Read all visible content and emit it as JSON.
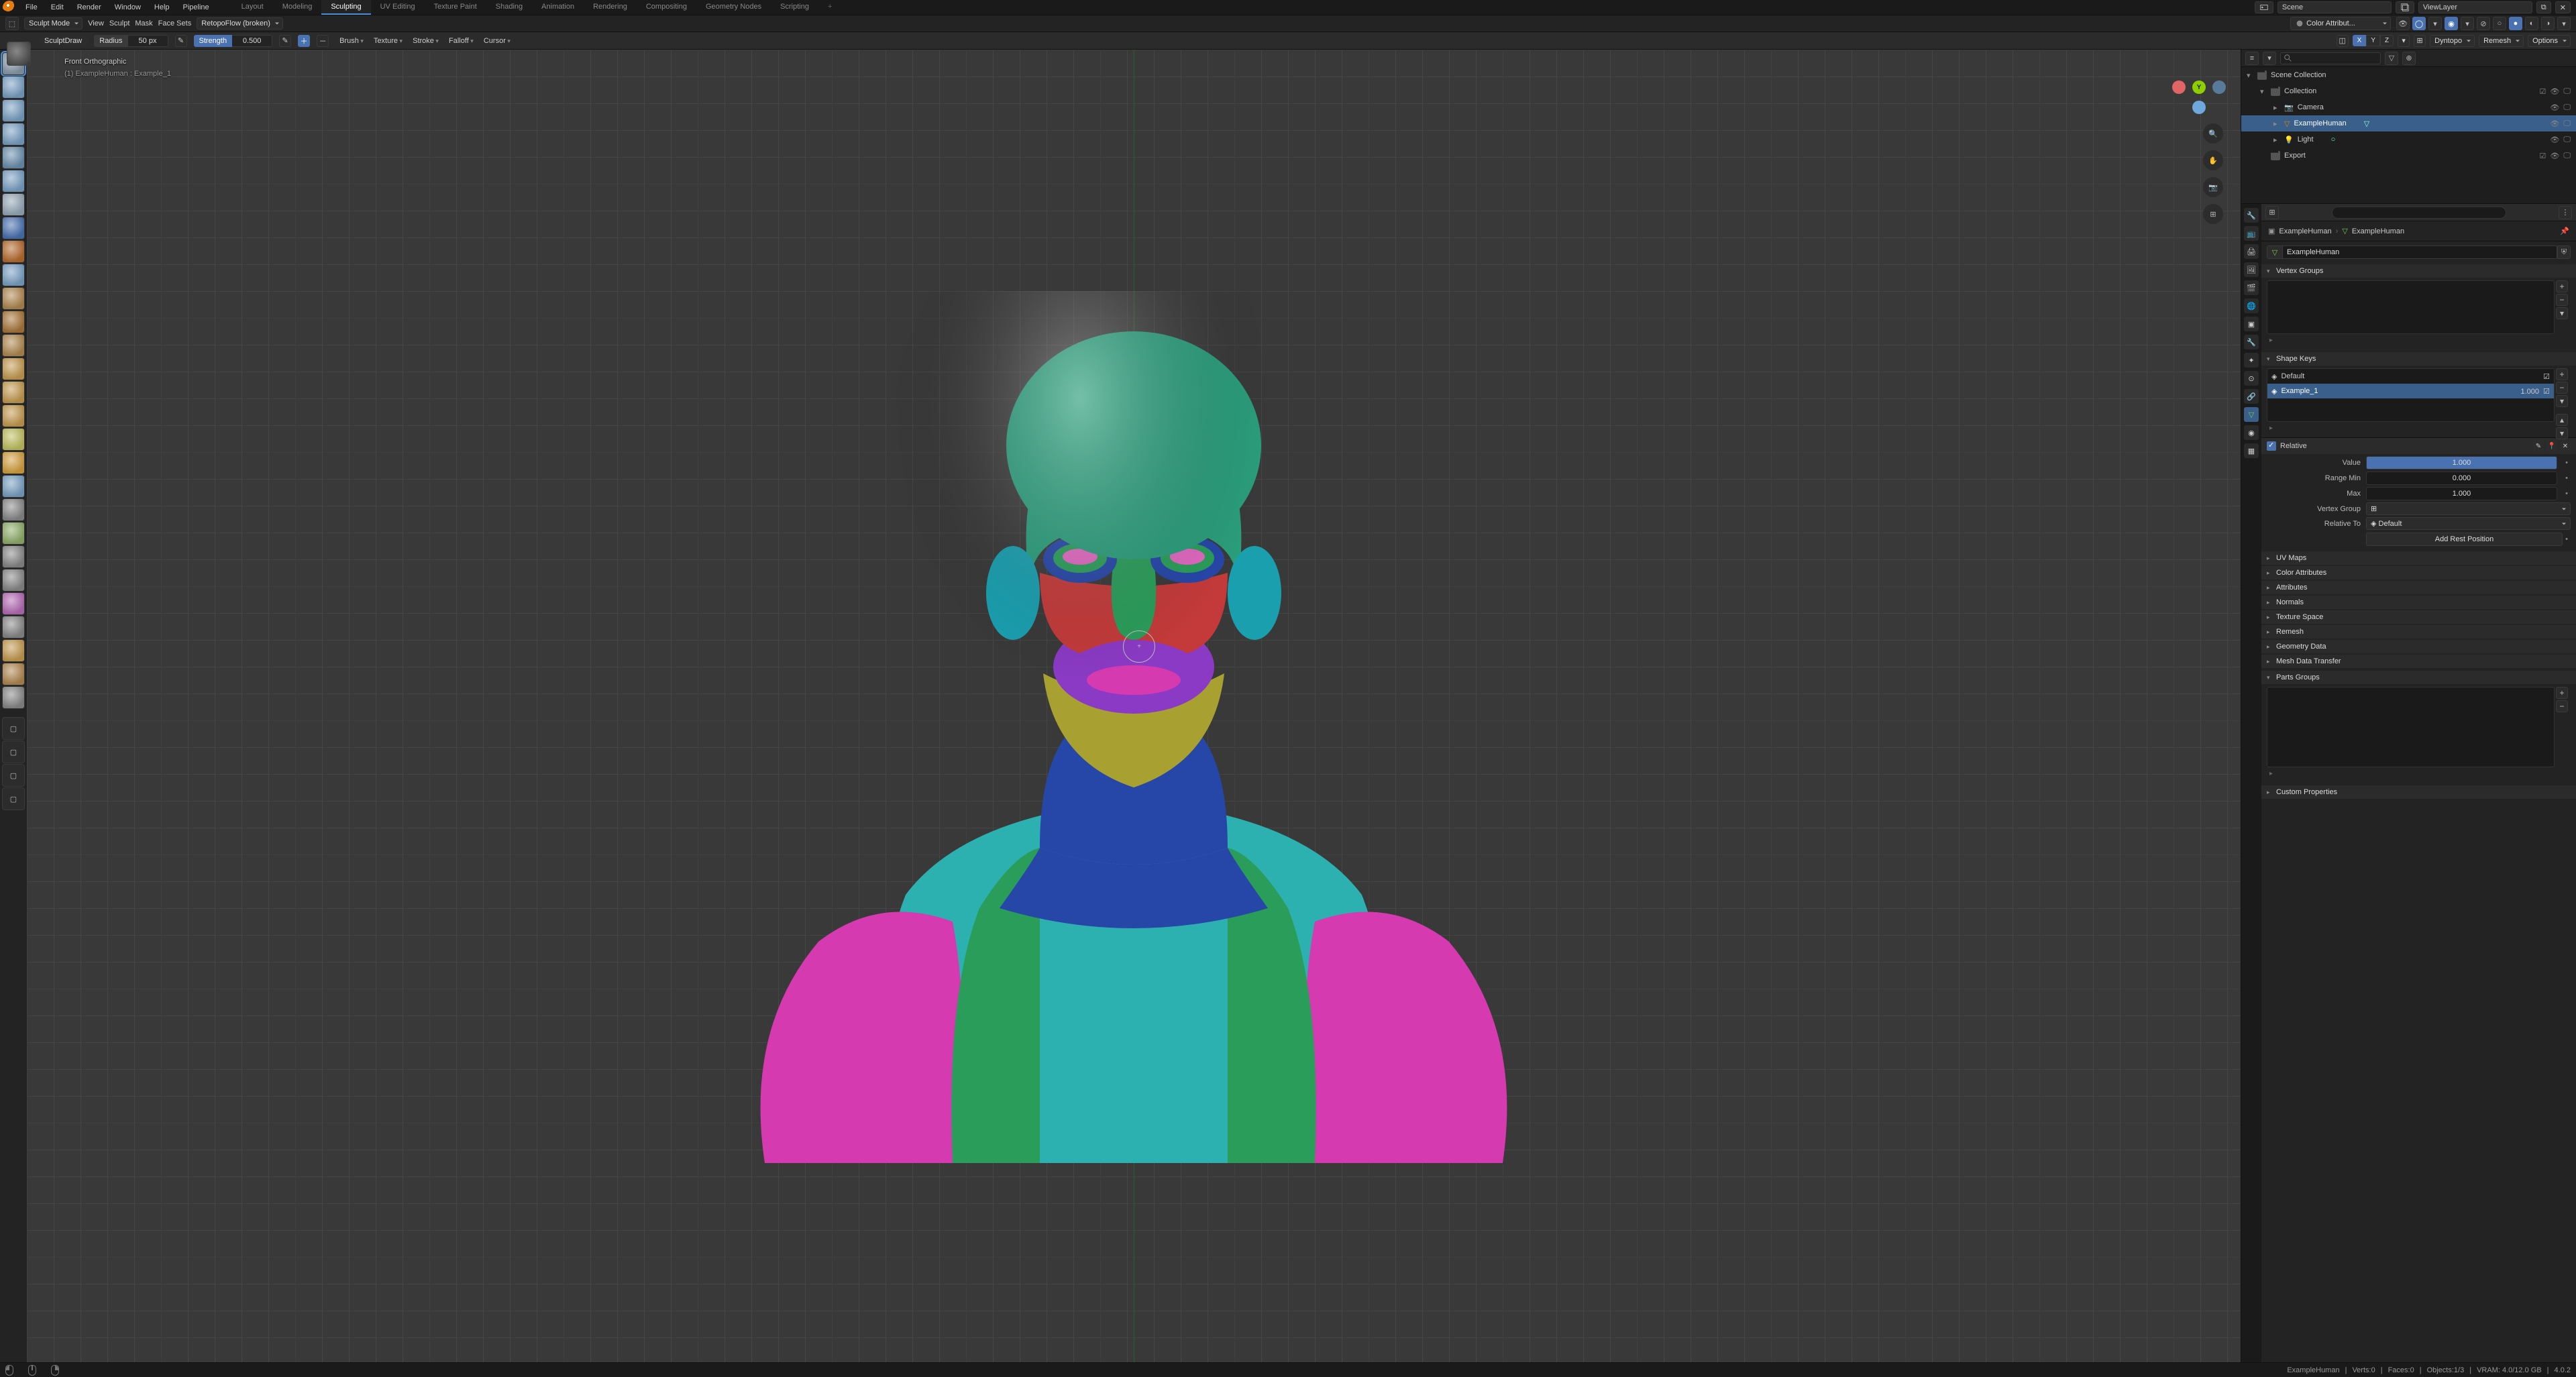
{
  "app": {
    "menus": [
      "File",
      "Edit",
      "Render",
      "Window",
      "Help"
    ],
    "addon_menu": "Pipeline",
    "workspaces": [
      "Layout",
      "Modeling",
      "Sculpting",
      "UV Editing",
      "Texture Paint",
      "Shading",
      "Animation",
      "Rendering",
      "Compositing",
      "Geometry Nodes",
      "Scripting"
    ],
    "active_workspace": "Sculpting",
    "scene_label": "Scene",
    "viewlayer_label": "ViewLayer"
  },
  "header": {
    "mode": "Sculpt Mode",
    "view": "View",
    "sculpt": "Sculpt",
    "mask": "Mask",
    "facesets": "Face Sets",
    "retopoflow": "RetopoFlow (broken)",
    "color_attr": "Color Attribut..."
  },
  "tool": {
    "brush": "SculptDraw",
    "radius_label": "Radius",
    "radius_value": "50 px",
    "strength_label": "Strength",
    "strength_value": "0.500",
    "menus": [
      "Brush",
      "Texture",
      "Stroke",
      "Falloff",
      "Cursor"
    ],
    "sym_axes": [
      "X",
      "Y",
      "Z"
    ],
    "right_menus": [
      "Dyntopo",
      "Remesh",
      "Options"
    ]
  },
  "viewport": {
    "projection": "Front Orthographic",
    "context": "(1) ExampleHuman : Example_1"
  },
  "outliner": {
    "root": "Scene Collection",
    "collection": "Collection",
    "items": [
      {
        "name": "Camera",
        "type": "camera"
      },
      {
        "name": "ExampleHuman",
        "type": "mesh",
        "selected": true
      },
      {
        "name": "Light",
        "type": "light"
      }
    ],
    "export": "Export"
  },
  "properties": {
    "breadcrumb_obj": "ExampleHuman",
    "breadcrumb_data": "ExampleHuman",
    "mesh_name": "ExampleHuman",
    "panels_closed": [
      "UV Maps",
      "Color Attributes",
      "Attributes",
      "Normals",
      "Texture Space",
      "Remesh",
      "Geometry Data",
      "Mesh Data Transfer",
      "Parts Groups",
      "Custom Properties"
    ],
    "vertex_groups_title": "Vertex Groups",
    "shape_keys": {
      "title": "Shape Keys",
      "basis": "Default",
      "active": "Example_1",
      "active_value": "1.000",
      "relative_label": "Relative",
      "value_label": "Value",
      "value": "1.000",
      "range_min_label": "Range Min",
      "range_min": "0.000",
      "max_label": "Max",
      "max": "1.000",
      "vgroup_label": "Vertex Group",
      "relative_to_label": "Relative To",
      "relative_to": "Default",
      "add_rest": "Add Rest Position"
    }
  },
  "status": {
    "right": [
      "ExampleHuman",
      "Verts:0",
      "Faces:0",
      "Objects:1/3",
      "VRAM: 4.0/12.0 GB",
      "4.0.2"
    ]
  },
  "tool_icons": [
    "#8899aa",
    "#7aa0c4",
    "#7aa0c4",
    "#7aa0c4",
    "#6b8fae",
    "#7aa0c4",
    "#96a8b8",
    "#4a72b0",
    "#b56b2e",
    "#7aa0c4",
    "#b08850",
    "#a8763a",
    "#b08850",
    "#c49a50",
    "#c49a50",
    "#c49a50",
    "#c0c060",
    "#d4a040",
    "#7aa0c4",
    "#888",
    "#8fae6b",
    "#888",
    "#888",
    "#b56bb5",
    "#888",
    "#c49a50",
    "#b08850",
    "#888"
  ]
}
